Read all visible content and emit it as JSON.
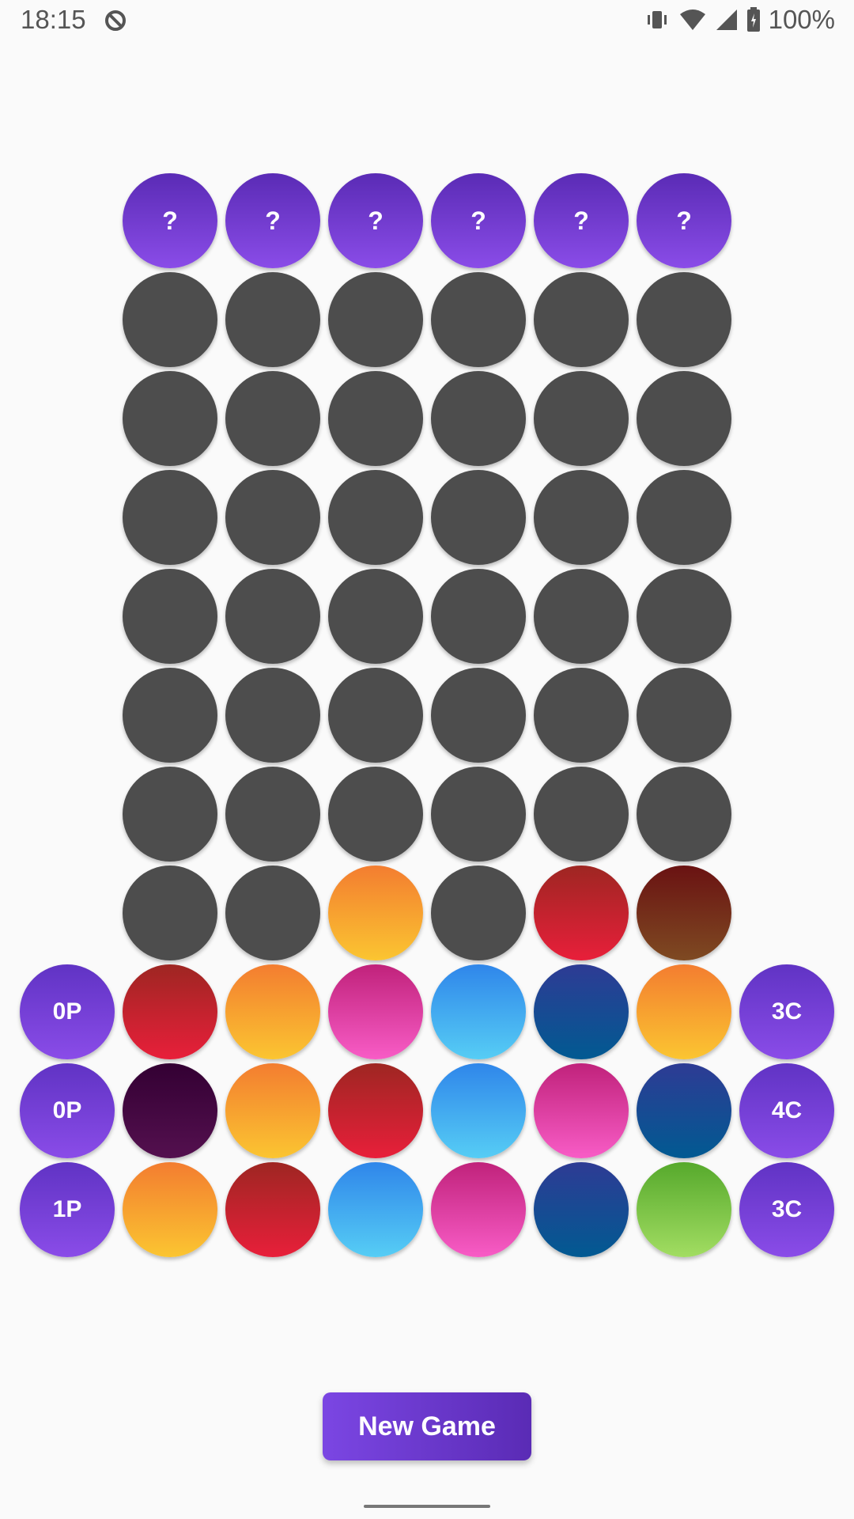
{
  "status_bar": {
    "time": "18:15",
    "battery": "100%"
  },
  "secret_row": [
    "?",
    "?",
    "?",
    "?",
    "?",
    "?"
  ],
  "board": {
    "empty_rows": 7,
    "columns": 6,
    "guess_row_8": [
      "empty",
      "empty",
      "orange",
      "empty",
      "red",
      "brown"
    ]
  },
  "guesses": [
    {
      "placed": "0P",
      "colors": [
        "red",
        "orange",
        "pink",
        "sky",
        "navy",
        "orange"
      ],
      "correct": "3C"
    },
    {
      "placed": "0P",
      "colors": [
        "plum",
        "orange",
        "red",
        "sky",
        "pink",
        "navy"
      ],
      "correct": "4C"
    },
    {
      "placed": "1P",
      "colors": [
        "orange",
        "red",
        "sky",
        "pink",
        "navy",
        "green"
      ],
      "correct": "3C"
    }
  ],
  "new_game_label": "New Game"
}
